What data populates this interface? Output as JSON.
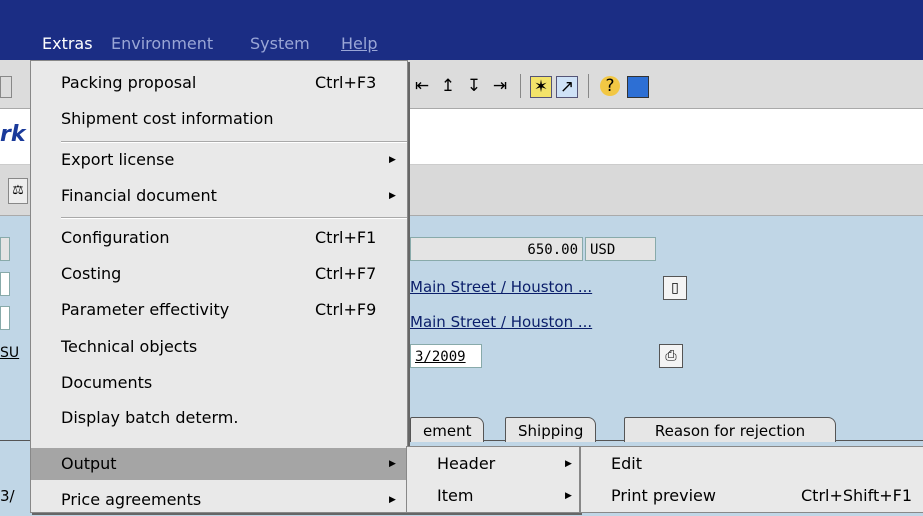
{
  "menubar": {
    "extras": "Extras",
    "environment": "Environment",
    "system": "System",
    "help": "Help"
  },
  "title_fragment": "rk",
  "form": {
    "net_value": "650.00",
    "currency": "USD",
    "sold_to": "Main Street / Houston ...",
    "ship_to": "Main Street / Houston ...",
    "date": "3/2009",
    "left_fragment": "SU",
    "row_fragment": "3/"
  },
  "tabs": [
    "ement",
    "Shipping",
    "Reason for rejection"
  ],
  "extras_menu": {
    "items": [
      {
        "label": "Packing proposal",
        "shortcut": "Ctrl+F3"
      },
      {
        "label": "Shipment cost information",
        "shortcut": ""
      },
      {
        "label": "Export license",
        "shortcut": "",
        "submenu": true
      },
      {
        "label": "Financial document",
        "shortcut": "",
        "submenu": true
      },
      {
        "label": "Configuration",
        "shortcut": "Ctrl+F1"
      },
      {
        "label": "Costing",
        "shortcut": "Ctrl+F7"
      },
      {
        "label": "Parameter effectivity",
        "shortcut": "Ctrl+F9"
      },
      {
        "label": "Technical objects",
        "shortcut": ""
      },
      {
        "label": "Documents",
        "shortcut": ""
      },
      {
        "label": "Display batch determ.",
        "shortcut": ""
      },
      {
        "label": "Output",
        "shortcut": "",
        "submenu": true
      },
      {
        "label": "Price agreements",
        "shortcut": "",
        "submenu": true
      }
    ]
  },
  "output_submenu": {
    "items": [
      {
        "label": "Header",
        "submenu": true
      },
      {
        "label": "Item",
        "submenu": true
      }
    ]
  },
  "header_submenu": {
    "items": [
      {
        "label": "Edit",
        "shortcut": ""
      },
      {
        "label": "Print preview",
        "shortcut": "Ctrl+Shift+F1"
      }
    ]
  }
}
